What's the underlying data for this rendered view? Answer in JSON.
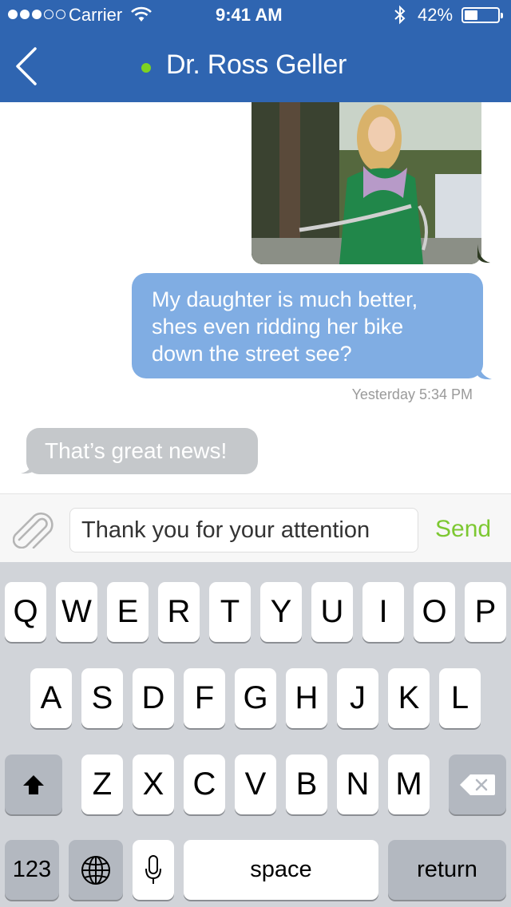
{
  "status_bar": {
    "carrier": "Carrier",
    "time": "9:41 AM",
    "battery_percent": "42%",
    "signal_bars_filled": 3,
    "signal_bars_total": 5,
    "battery_level": 0.42
  },
  "header": {
    "contact_name": "Dr. Ross Geller",
    "online_status_color": "#7dd321",
    "back_icon": "chevron-left-icon"
  },
  "messages": {
    "photo": "photo of girl riding a bike",
    "outgoing_text_lines": [
      "My daughter is much better,",
      "shes even ridding her bike",
      "down the street see?"
    ],
    "timestamp": "Yesterday 5:34 PM",
    "incoming_text": "That’s great news!"
  },
  "compose": {
    "input_value": "Thank you for your attention",
    "send_label": "Send",
    "attach_icon": "paperclip-icon"
  },
  "keyboard": {
    "row1": [
      "Q",
      "W",
      "E",
      "R",
      "T",
      "Y",
      "U",
      "I",
      "O",
      "P"
    ],
    "row2": [
      "A",
      "S",
      "D",
      "F",
      "G",
      "H",
      "J",
      "K",
      "L"
    ],
    "row3": [
      "Z",
      "X",
      "C",
      "V",
      "B",
      "N",
      "M"
    ],
    "numbers_label": "123",
    "space_label": "space",
    "return_label": "return"
  },
  "colors": {
    "header": "#2f65b1",
    "outgoing_bubble": "#80ade3",
    "incoming_bubble": "#c5c8cb",
    "send": "#7dc832"
  }
}
